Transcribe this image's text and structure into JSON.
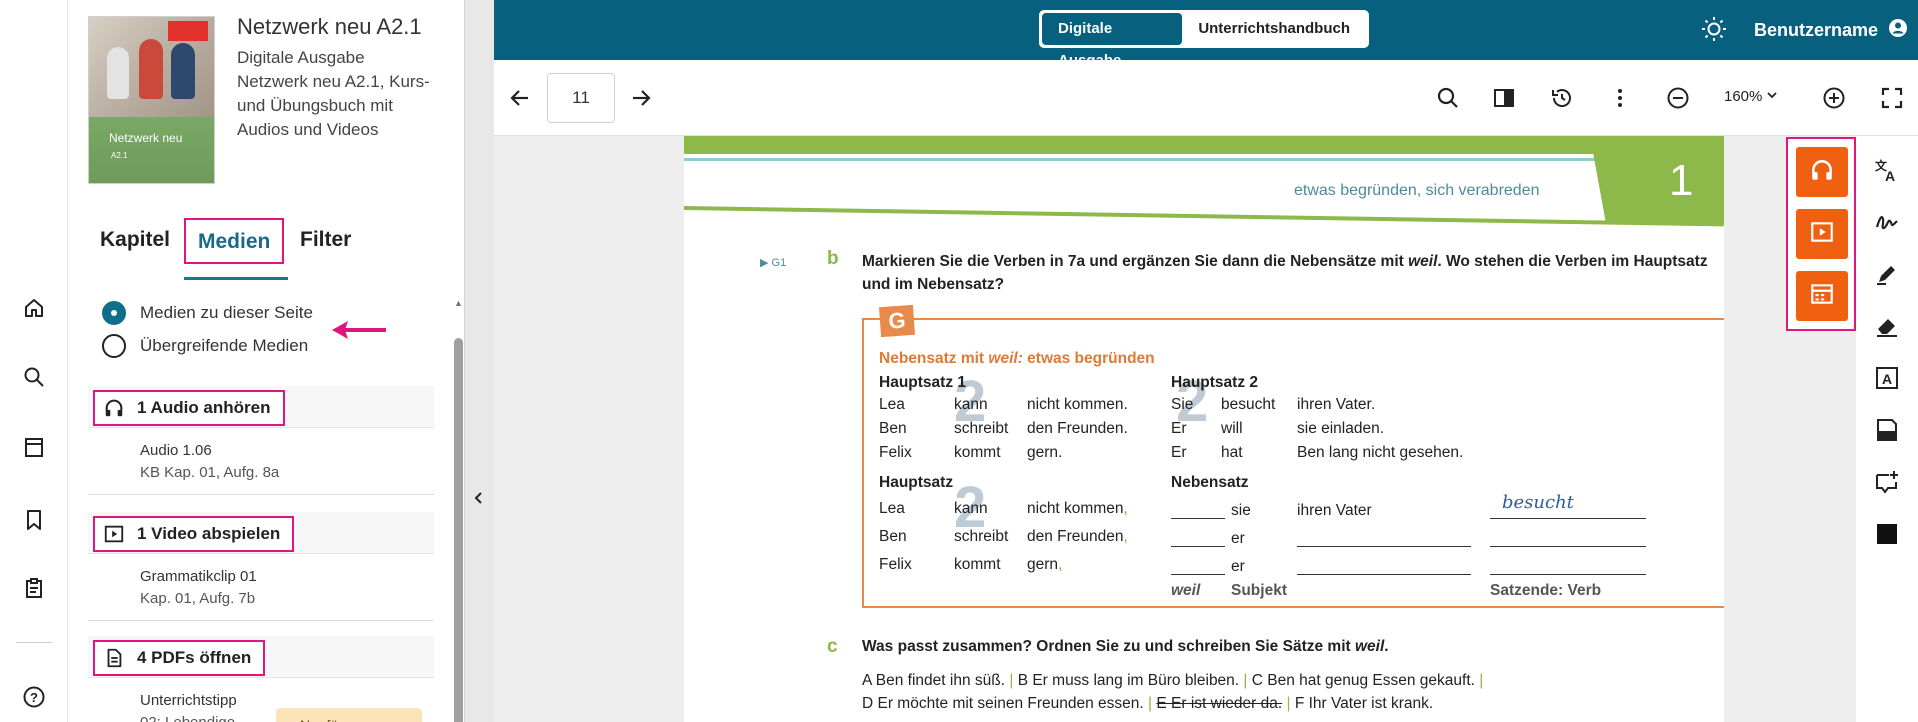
{
  "rail": {
    "icons": [
      "home-icon",
      "search-icon",
      "book-icon",
      "bookmark-icon",
      "clipboard-icon",
      "help-icon"
    ]
  },
  "book": {
    "title": "Netzwerk neu A2.1",
    "edition": "Digitale Ausgabe",
    "description": "Netzwerk neu A2.1, Kurs- und Übungsbuch mit Audios und Videos",
    "cover_title": "Netzwerk neu",
    "cover_sub": "A2.1"
  },
  "tabs": [
    {
      "label": "Kapitel"
    },
    {
      "label": "Medien",
      "active": true
    },
    {
      "label": "Filter"
    }
  ],
  "media_scope": {
    "options": [
      "Medien zu dieser Seite",
      "Übergreifende Medien"
    ],
    "selected": "Medien zu dieser Seite"
  },
  "sections": {
    "audio": {
      "header": "1 Audio anhören",
      "items": [
        {
          "title": "Audio 1.06",
          "subtitle": "KB Kap. 01, Aufg. 8a"
        }
      ]
    },
    "video": {
      "header": "1 Video abspielen",
      "items": [
        {
          "title": "Grammatikclip 01",
          "subtitle": "Kap. 01, Aufg. 7b"
        }
      ]
    },
    "pdf": {
      "header": "4 PDFs öffnen",
      "items": [
        {
          "title": "Unterrichtstipp",
          "subtitle": "02: Lebendige",
          "tag": "Nur für"
        }
      ]
    }
  },
  "topbar": {
    "toggle": [
      "Digitale Ausgabe",
      "Unterrichtshandbuch"
    ],
    "toggle_selected": "Digitale Ausgabe",
    "username": "Benutzername"
  },
  "toolbar": {
    "page": "11",
    "zoom": "160%"
  },
  "page_content": {
    "chapter_number": "1",
    "subheading": "etwas begründen, sich verabreden",
    "exercise_ref": "G1",
    "exercise_b_letter": "b",
    "exercise_b_text_1": "Markieren Sie die Verben in 7a und ergänzen Sie dann die Nebensätze mit",
    "exercise_b_weil": "weil",
    "exercise_b_text_2": ". Wo stehen die Verben im Hauptsatz und im Nebensatz?",
    "grammar_tag": "G",
    "grammar_title_1": "Nebensatz mit",
    "grammar_title_weil": "weil:",
    "grammar_title_2": "etwas begründen",
    "hauptsatz1": "Hauptsatz 1",
    "hauptsatz2": "Hauptsatz 2",
    "hauptsatz": "Hauptsatz",
    "nebensatz": "Nebensatz",
    "rows_h1": [
      [
        "Lea",
        "kann",
        "nicht kommen."
      ],
      [
        "Ben",
        "schreibt",
        "den Freunden."
      ],
      [
        "Felix",
        "kommt",
        "gern."
      ]
    ],
    "rows_h2": [
      [
        "Sie",
        "besucht",
        "ihren Vater."
      ],
      [
        "Er",
        "will",
        "sie einladen."
      ],
      [
        "Er",
        "hat",
        "Ben lang nicht gesehen."
      ]
    ],
    "rows_h": [
      [
        "Lea",
        "kann",
        "nicht kommen"
      ],
      [
        "Ben",
        "schreibt",
        "den Freunden"
      ],
      [
        "Felix",
        "kommt",
        "gern"
      ]
    ],
    "rows_n": [
      [
        "sie",
        "ihren Vater"
      ],
      [
        "er",
        ""
      ],
      [
        "er",
        ""
      ]
    ],
    "handwritten": "besucht",
    "foot_weil": "weil",
    "foot_subjekt": "Subjekt",
    "foot_verb": "Satzende: Verb",
    "big_number": "2",
    "exercise_c_letter": "c",
    "exercise_c_text_1": "Was passt zusammen? Ordnen Sie zu und schreiben Sie Sätze mit",
    "exercise_c_weil": "weil",
    "exercise_c_text_2": ".",
    "c_line1": [
      "A Ben findet ihn süß.",
      "B Er muss lang im Büro bleiben.",
      "C Ben hat genug Essen gekauft."
    ],
    "c_line2": [
      "D Er möchte mit seinen Freunden essen.",
      "E Er ist wieder da.",
      "F Ihr Vater ist krank."
    ]
  },
  "media_buttons": [
    "headphones-icon",
    "video-play-icon",
    "media-library-icon"
  ],
  "tools": [
    "translate-icon",
    "signature-icon",
    "pen-icon",
    "eraser-icon",
    "text-box-icon",
    "sticky-note-icon",
    "add-comment-icon",
    "black-square-icon"
  ],
  "colors": {
    "topbar": "#07617e",
    "accent_pink": "#e0157e",
    "media_orange": "#f06010",
    "chapter_green": "#8db84a",
    "grammar_orange": "#e88b4a"
  }
}
